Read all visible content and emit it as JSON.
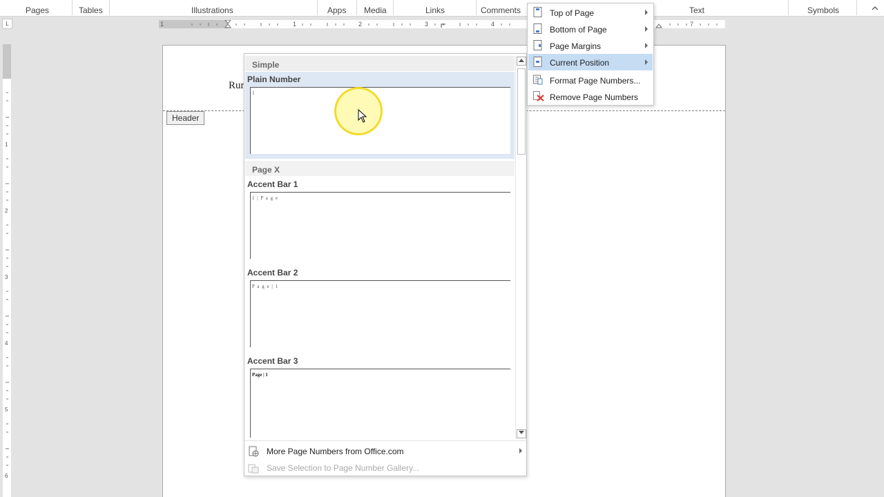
{
  "ribbon": {
    "groups": [
      "Pages",
      "Tables",
      "Illustrations",
      "Apps",
      "Media",
      "Links",
      "Comments",
      "Text",
      "Symbols"
    ],
    "collapse_icon": "chevron-up-icon"
  },
  "ruler": {
    "tab_selector": "L",
    "h_numbers": [
      "1",
      "1",
      "2",
      "3",
      "4",
      "7"
    ],
    "v_numbers": [
      "1",
      "2",
      "3",
      "4",
      "5",
      "6"
    ]
  },
  "document": {
    "body_text": "Rur",
    "header_tag": "Header"
  },
  "gallery": {
    "categories": [
      "Simple",
      "Page X"
    ],
    "items": [
      {
        "title": "Plain Number",
        "sample": "1"
      },
      {
        "title": "Accent Bar 1",
        "sample": "1 | P a g e"
      },
      {
        "title": "Accent Bar 2",
        "sample": "P a g e  | 1"
      },
      {
        "title": "Accent Bar 3",
        "sample": "Page | 1"
      }
    ],
    "footer": {
      "more": "More Page Numbers from Office.com",
      "save": "Save Selection to Page Number Gallery..."
    }
  },
  "menu": {
    "items": [
      {
        "label": "Top of Page",
        "icon": "page-top-icon",
        "has_submenu": true
      },
      {
        "label": "Bottom of Page",
        "icon": "page-bottom-icon",
        "has_submenu": true
      },
      {
        "label": "Page Margins",
        "icon": "page-margins-icon",
        "has_submenu": true
      },
      {
        "label": "Current Position",
        "icon": "current-position-icon",
        "has_submenu": true,
        "highlighted": true
      },
      {
        "label": "Format Page Numbers...",
        "icon": "format-page-numbers-icon",
        "has_submenu": false
      },
      {
        "label": "Remove Page Numbers",
        "icon": "remove-icon",
        "has_submenu": false
      }
    ]
  },
  "colors": {
    "highlight": "#c5dcf3",
    "selected_item": "#dde8f4",
    "cursor_halo": "#f2e52a",
    "remove_red": "#d9302a"
  }
}
